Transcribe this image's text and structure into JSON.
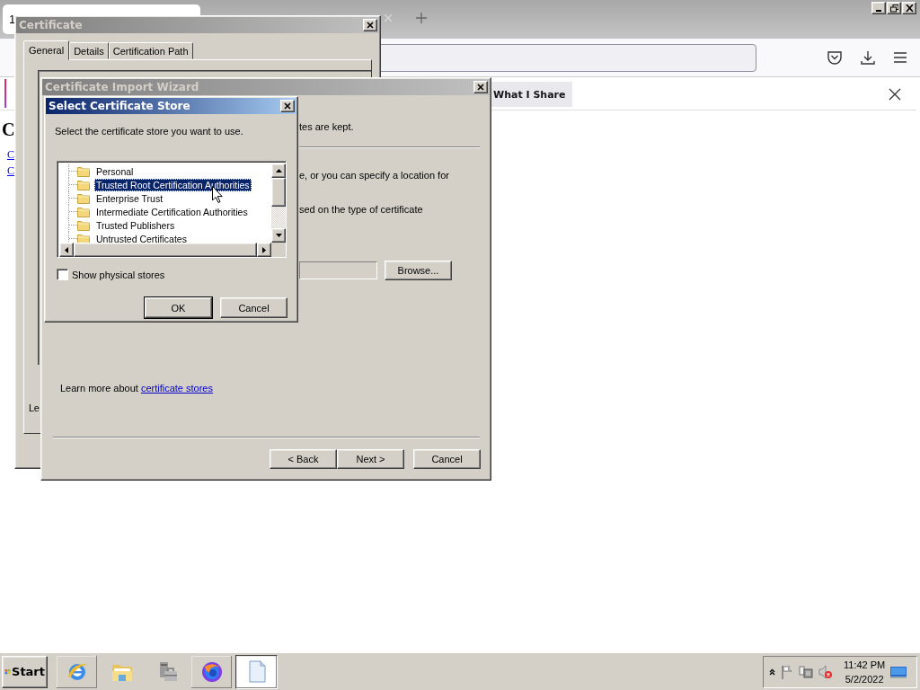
{
  "browser": {
    "tab": {
      "title": "1"
    },
    "notification": {
      "button": "What I Share"
    },
    "page": {
      "heading": "C",
      "links": [
        "C",
        "C"
      ]
    }
  },
  "certificate_window": {
    "title": "Certificate",
    "tabs": [
      {
        "label": "General",
        "selected": true
      },
      {
        "label": "Details",
        "selected": false
      },
      {
        "label": "Certification Path",
        "selected": false
      }
    ],
    "footer_text": "Le"
  },
  "wizard": {
    "title": "Certificate Import Wizard",
    "texts": [
      "tes are kept.",
      "e, or you can specify a location for",
      "sed on the type of certificate"
    ],
    "browse_button": "Browse...",
    "learn_more": {
      "text": "Learn more about ",
      "link": "certificate stores"
    },
    "buttons": [
      "< Back",
      "Next >",
      "Cancel"
    ]
  },
  "store_dialog": {
    "title": "Select Certificate Store",
    "prompt": "Select the certificate store you want to use.",
    "stores": [
      {
        "label": "Personal",
        "selected": false
      },
      {
        "label": "Trusted Root Certification Authorities",
        "selected": true
      },
      {
        "label": "Enterprise Trust",
        "selected": false
      },
      {
        "label": "Intermediate Certification Authorities",
        "selected": false
      },
      {
        "label": "Trusted Publishers",
        "selected": false
      },
      {
        "label": "Untrusted Certificates",
        "selected": false
      }
    ],
    "show_physical_stores": {
      "label": "Show physical stores",
      "checked": false
    },
    "buttons": [
      {
        "label": "OK",
        "default": true
      },
      {
        "label": "Cancel",
        "default": false
      }
    ]
  },
  "taskbar": {
    "start": "Start",
    "apps": [
      {
        "kind": "globe",
        "running": true,
        "selected": false
      },
      {
        "kind": "folder",
        "running": false,
        "selected": false
      },
      {
        "kind": "toolbox",
        "running": false,
        "selected": false
      },
      {
        "kind": "swirl",
        "running": true,
        "selected": false
      },
      {
        "kind": "document",
        "running": true,
        "selected": true
      }
    ],
    "clock": {
      "time": "11:42 PM",
      "date": "5/2/2022"
    }
  }
}
